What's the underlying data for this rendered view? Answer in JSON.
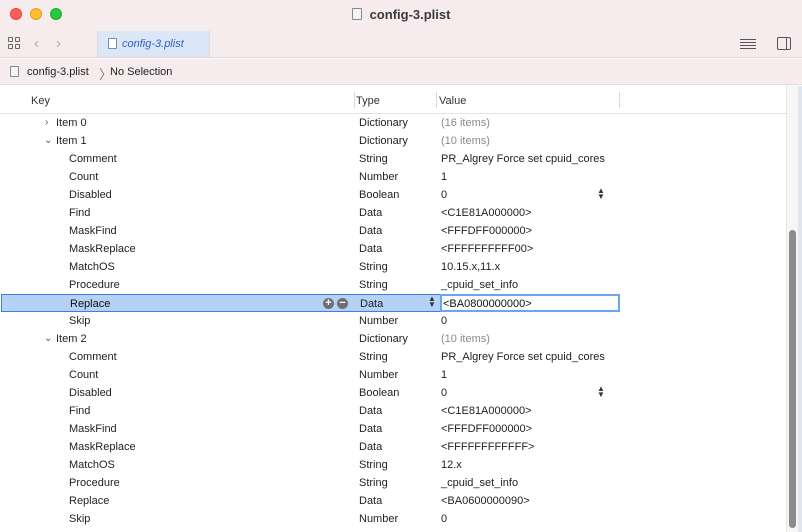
{
  "window": {
    "title": "config-3.plist"
  },
  "tab": {
    "label": "config-3.plist"
  },
  "jumpbar": {
    "file": "config-3.plist",
    "selection": "No Selection"
  },
  "columns": {
    "key": "Key",
    "type": "Type",
    "value": "Value"
  },
  "rows": [
    {
      "key": "Item 0",
      "type": "Dictionary",
      "value": "(16 items)"
    },
    {
      "key": "Item 1",
      "type": "Dictionary",
      "value": "(10 items)"
    },
    {
      "key": "Comment",
      "type": "String",
      "value": "PR_Algrey Force set cpuid_cores"
    },
    {
      "key": "Count",
      "type": "Number",
      "value": "1"
    },
    {
      "key": "Disabled",
      "type": "Boolean",
      "value": "0"
    },
    {
      "key": "Find",
      "type": "Data",
      "value": "<C1E81A000000>"
    },
    {
      "key": "MaskFind",
      "type": "Data",
      "value": "<FFFDFF000000>"
    },
    {
      "key": "MaskReplace",
      "type": "Data",
      "value": "<FFFFFFFFFF00>"
    },
    {
      "key": "MatchOS",
      "type": "String",
      "value": "10.15.x,11.x"
    },
    {
      "key": "Procedure",
      "type": "String",
      "value": "_cpuid_set_info"
    },
    {
      "key": "Replace",
      "type": "Data",
      "value": "<BA0800000000>"
    },
    {
      "key": "Skip",
      "type": "Number",
      "value": "0"
    },
    {
      "key": "Item 2",
      "type": "Dictionary",
      "value": "(10 items)"
    },
    {
      "key": "Comment",
      "type": "String",
      "value": "PR_Algrey Force set cpuid_cores"
    },
    {
      "key": "Count",
      "type": "Number",
      "value": "1"
    },
    {
      "key": "Disabled",
      "type": "Boolean",
      "value": "0"
    },
    {
      "key": "Find",
      "type": "Data",
      "value": "<C1E81A000000>"
    },
    {
      "key": "MaskFind",
      "type": "Data",
      "value": "<FFFDFF000000>"
    },
    {
      "key": "MaskReplace",
      "type": "Data",
      "value": "<FFFFFFFFFFFF>"
    },
    {
      "key": "MatchOS",
      "type": "String",
      "value": "12.x"
    },
    {
      "key": "Procedure",
      "type": "String",
      "value": "_cpuid_set_info"
    },
    {
      "key": "Replace",
      "type": "Data",
      "value": "<BA0600000090>"
    },
    {
      "key": "Skip",
      "type": "Number",
      "value": "0"
    }
  ],
  "icons": {
    "add": "+",
    "remove": "−",
    "collapsed": "›",
    "expanded": "⌄",
    "back": "‹",
    "forward": "›",
    "breadcrumb_separator": "〉"
  },
  "colors": {
    "selection": "#b5d1f6",
    "accent": "#3a80de",
    "tab_text": "#2a62c9"
  }
}
